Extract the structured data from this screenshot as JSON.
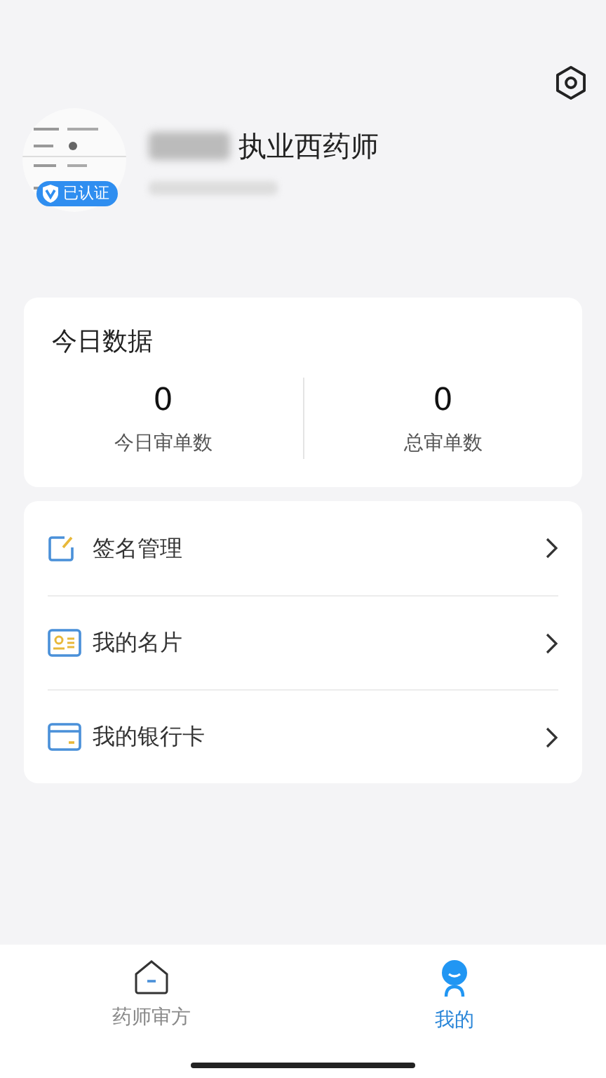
{
  "profile": {
    "title": "执业西药师",
    "badge": "已认证",
    "verified": true
  },
  "stats": {
    "title": "今日数据",
    "items": [
      {
        "value": "0",
        "label": "今日审单数"
      },
      {
        "value": "0",
        "label": "总审单数"
      }
    ]
  },
  "menu": [
    {
      "kind": "signature",
      "label": "签名管理"
    },
    {
      "kind": "card",
      "label": "我的名片"
    },
    {
      "kind": "bank",
      "label": "我的银行卡"
    }
  ],
  "tabs": [
    {
      "kind": "home",
      "label": "药师审方",
      "selected": false
    },
    {
      "kind": "me",
      "label": "我的",
      "selected": true
    }
  ]
}
